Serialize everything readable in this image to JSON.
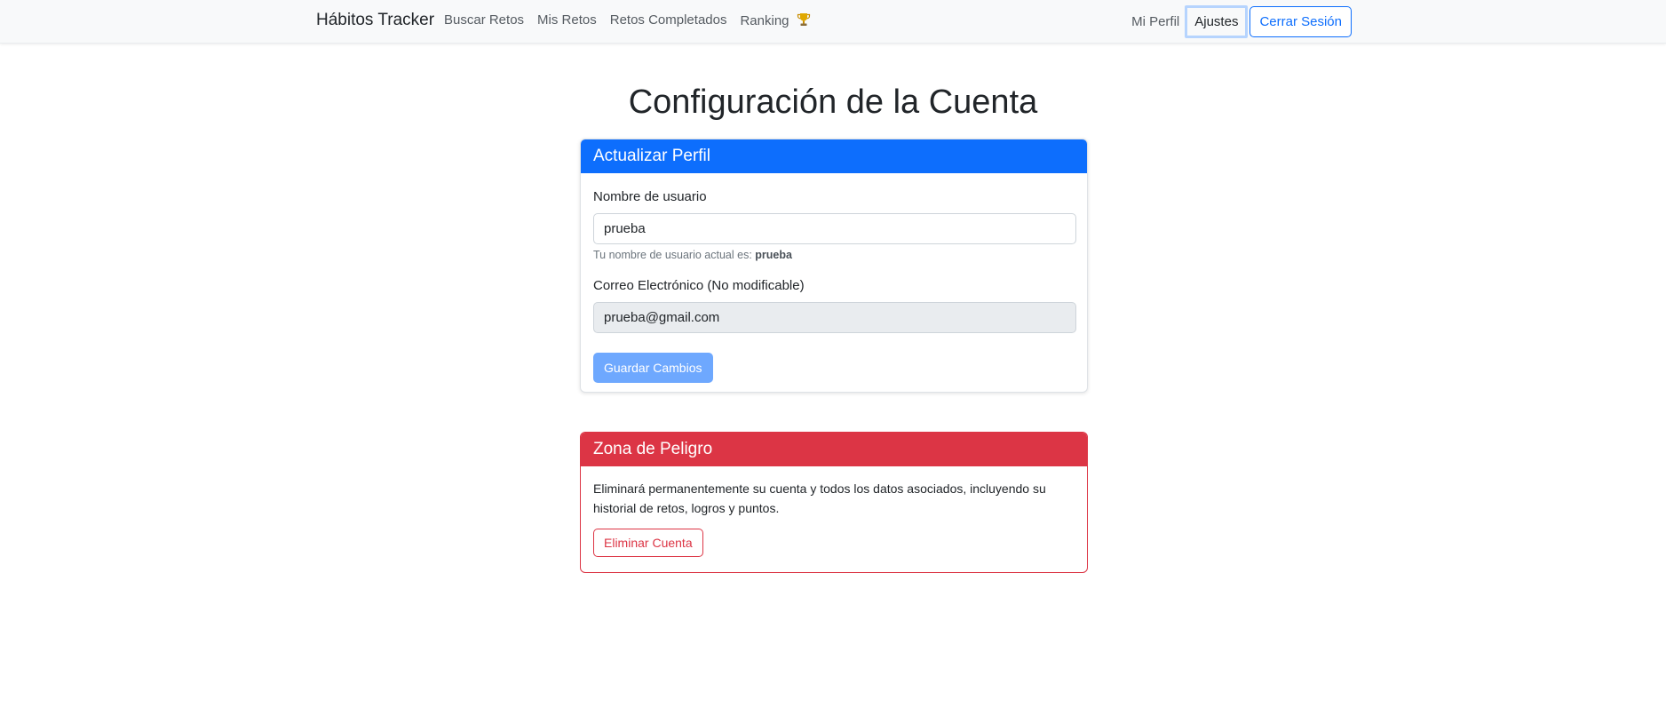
{
  "navbar": {
    "brand": "Hábitos Tracker",
    "links": [
      {
        "label": "Buscar Retos"
      },
      {
        "label": "Mis Retos"
      },
      {
        "label": "Retos Completados"
      },
      {
        "label": "Ranking"
      }
    ],
    "ranking_icon": "trophy-icon",
    "profile": "Mi Perfil",
    "settings": "Ajustes",
    "logout": "Cerrar Sesión"
  },
  "page": {
    "title": "Configuración de la Cuenta"
  },
  "profile_card": {
    "header": "Actualizar Perfil",
    "username_label": "Nombre de usuario",
    "username_value": "prueba",
    "username_help_prefix": "Tu nombre de usuario actual es:",
    "username_help_value": "prueba",
    "email_label": "Correo Electrónico (No modificable)",
    "email_value": "prueba@gmail.com",
    "save_button": "Guardar Cambios"
  },
  "danger_card": {
    "header": "Zona de Peligro",
    "description": "Eliminará permanentemente su cuenta y todos los datos asociados, incluyendo su historial de retos, logros y puntos.",
    "delete_button": "Eliminar Cuenta"
  },
  "colors": {
    "primary": "#0d6efd",
    "danger": "#dc3545",
    "navbar_bg": "#f8f9fa"
  }
}
